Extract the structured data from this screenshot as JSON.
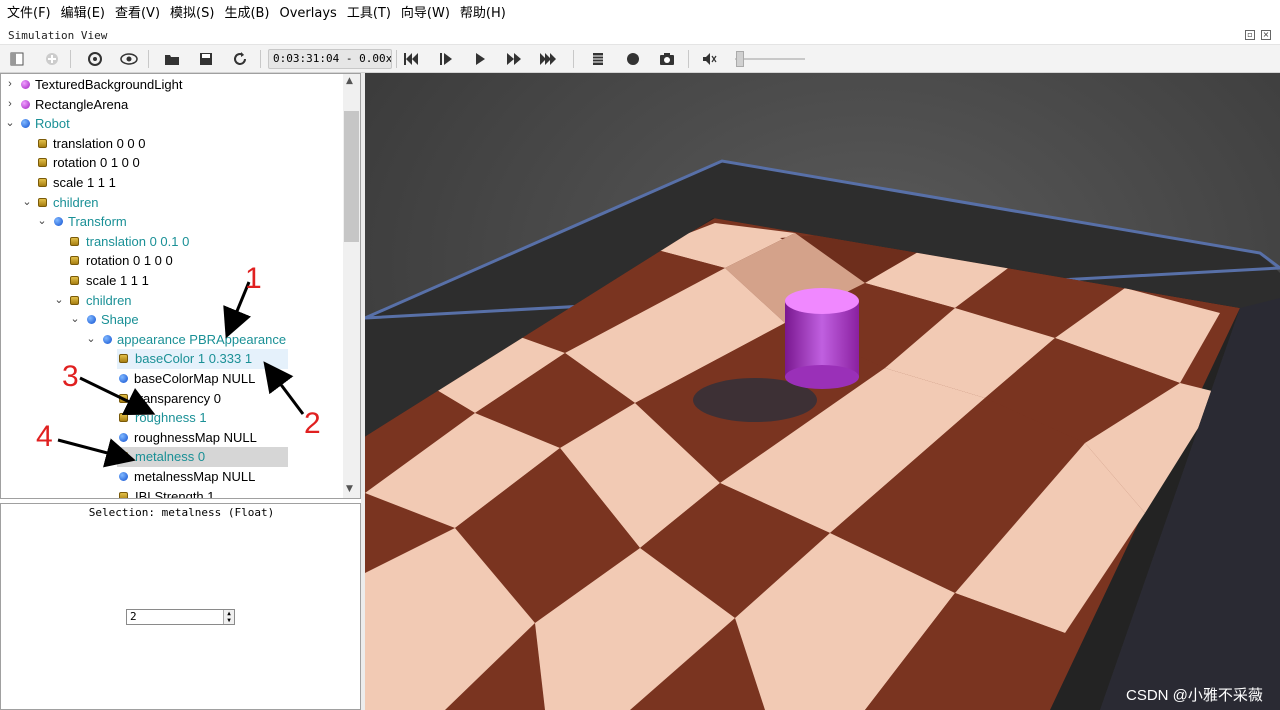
{
  "menu": [
    "文件(F)",
    "编辑(E)",
    "查看(V)",
    "模拟(S)",
    "生成(B)",
    "Overlays",
    "工具(T)",
    "向导(W)",
    "帮助(H)"
  ],
  "window": {
    "title": "Simulation View"
  },
  "toolbar": {
    "time": "0:03:31:04 -  0.00x",
    "icons": [
      "toggle-scene-tree-icon",
      "add-node-icon",
      "reload-world-icon",
      "view-icon",
      "open-world-icon",
      "save-world-icon",
      "refresh-icon",
      "step-backward-icon",
      "step-icon",
      "play-icon",
      "fast-forward-icon",
      "fastest-icon",
      "record-movie-icon",
      "record-animation-icon",
      "screenshot-icon",
      "volume-icon"
    ],
    "volume_level": 0
  },
  "tree": {
    "rows": [
      {
        "label": "TexturedBackgroundLight",
        "icon": "purple-node-icon",
        "chevron": "collapsed"
      },
      {
        "label": "RectangleArena",
        "icon": "purple-node-icon",
        "chevron": "collapsed"
      },
      {
        "label": "Robot",
        "icon": "blue-node-icon",
        "chevron": "expanded"
      },
      {
        "label": "translation 0 0 0",
        "icon": "field-icon"
      },
      {
        "label": "rotation 0 1 0 0",
        "icon": "field-icon"
      },
      {
        "label": "scale 1 1 1",
        "icon": "field-icon"
      },
      {
        "label": "children",
        "icon": "field-icon",
        "chevron": "expanded"
      },
      {
        "label": "Transform",
        "icon": "blue-node-icon",
        "chevron": "expanded"
      },
      {
        "label": "translation 0 0.1 0",
        "icon": "field-icon"
      },
      {
        "label": "rotation 0 1 0 0",
        "icon": "field-icon"
      },
      {
        "label": "scale 1 1 1",
        "icon": "field-icon"
      },
      {
        "label": "children",
        "icon": "field-icon",
        "chevron": "expanded"
      },
      {
        "label": "Shape",
        "icon": "blue-node-icon",
        "chevron": "expanded"
      },
      {
        "label": "appearance PBRAppearance",
        "icon": "blue-node-icon",
        "chevron": "expanded"
      },
      {
        "label": "baseColor 1 0.333 1",
        "icon": "field-icon"
      },
      {
        "label": "baseColorMap NULL",
        "icon": "blue-node-icon"
      },
      {
        "label": "transparency 0",
        "icon": "field-icon"
      },
      {
        "label": "roughness 1",
        "icon": "field-icon"
      },
      {
        "label": "roughnessMap NULL",
        "icon": "blue-node-icon"
      },
      {
        "label": "metalness 0",
        "icon": "field-icon"
      },
      {
        "label": "metalnessMap NULL",
        "icon": "blue-node-icon"
      },
      {
        "label": "IBLStrength 1",
        "icon": "field-icon"
      }
    ]
  },
  "field_editor": {
    "selection": "Selection: metalness (Float)",
    "value": "2"
  },
  "annotations": [
    "1",
    "2",
    "3",
    "4"
  ],
  "watermark": "CSDN @小雅不采薇",
  "colors": {
    "teal_text": "#1a9096",
    "cylinder": "#e070f0",
    "floor_dark": "#7a3420",
    "floor_light": "#f0c8b0"
  }
}
